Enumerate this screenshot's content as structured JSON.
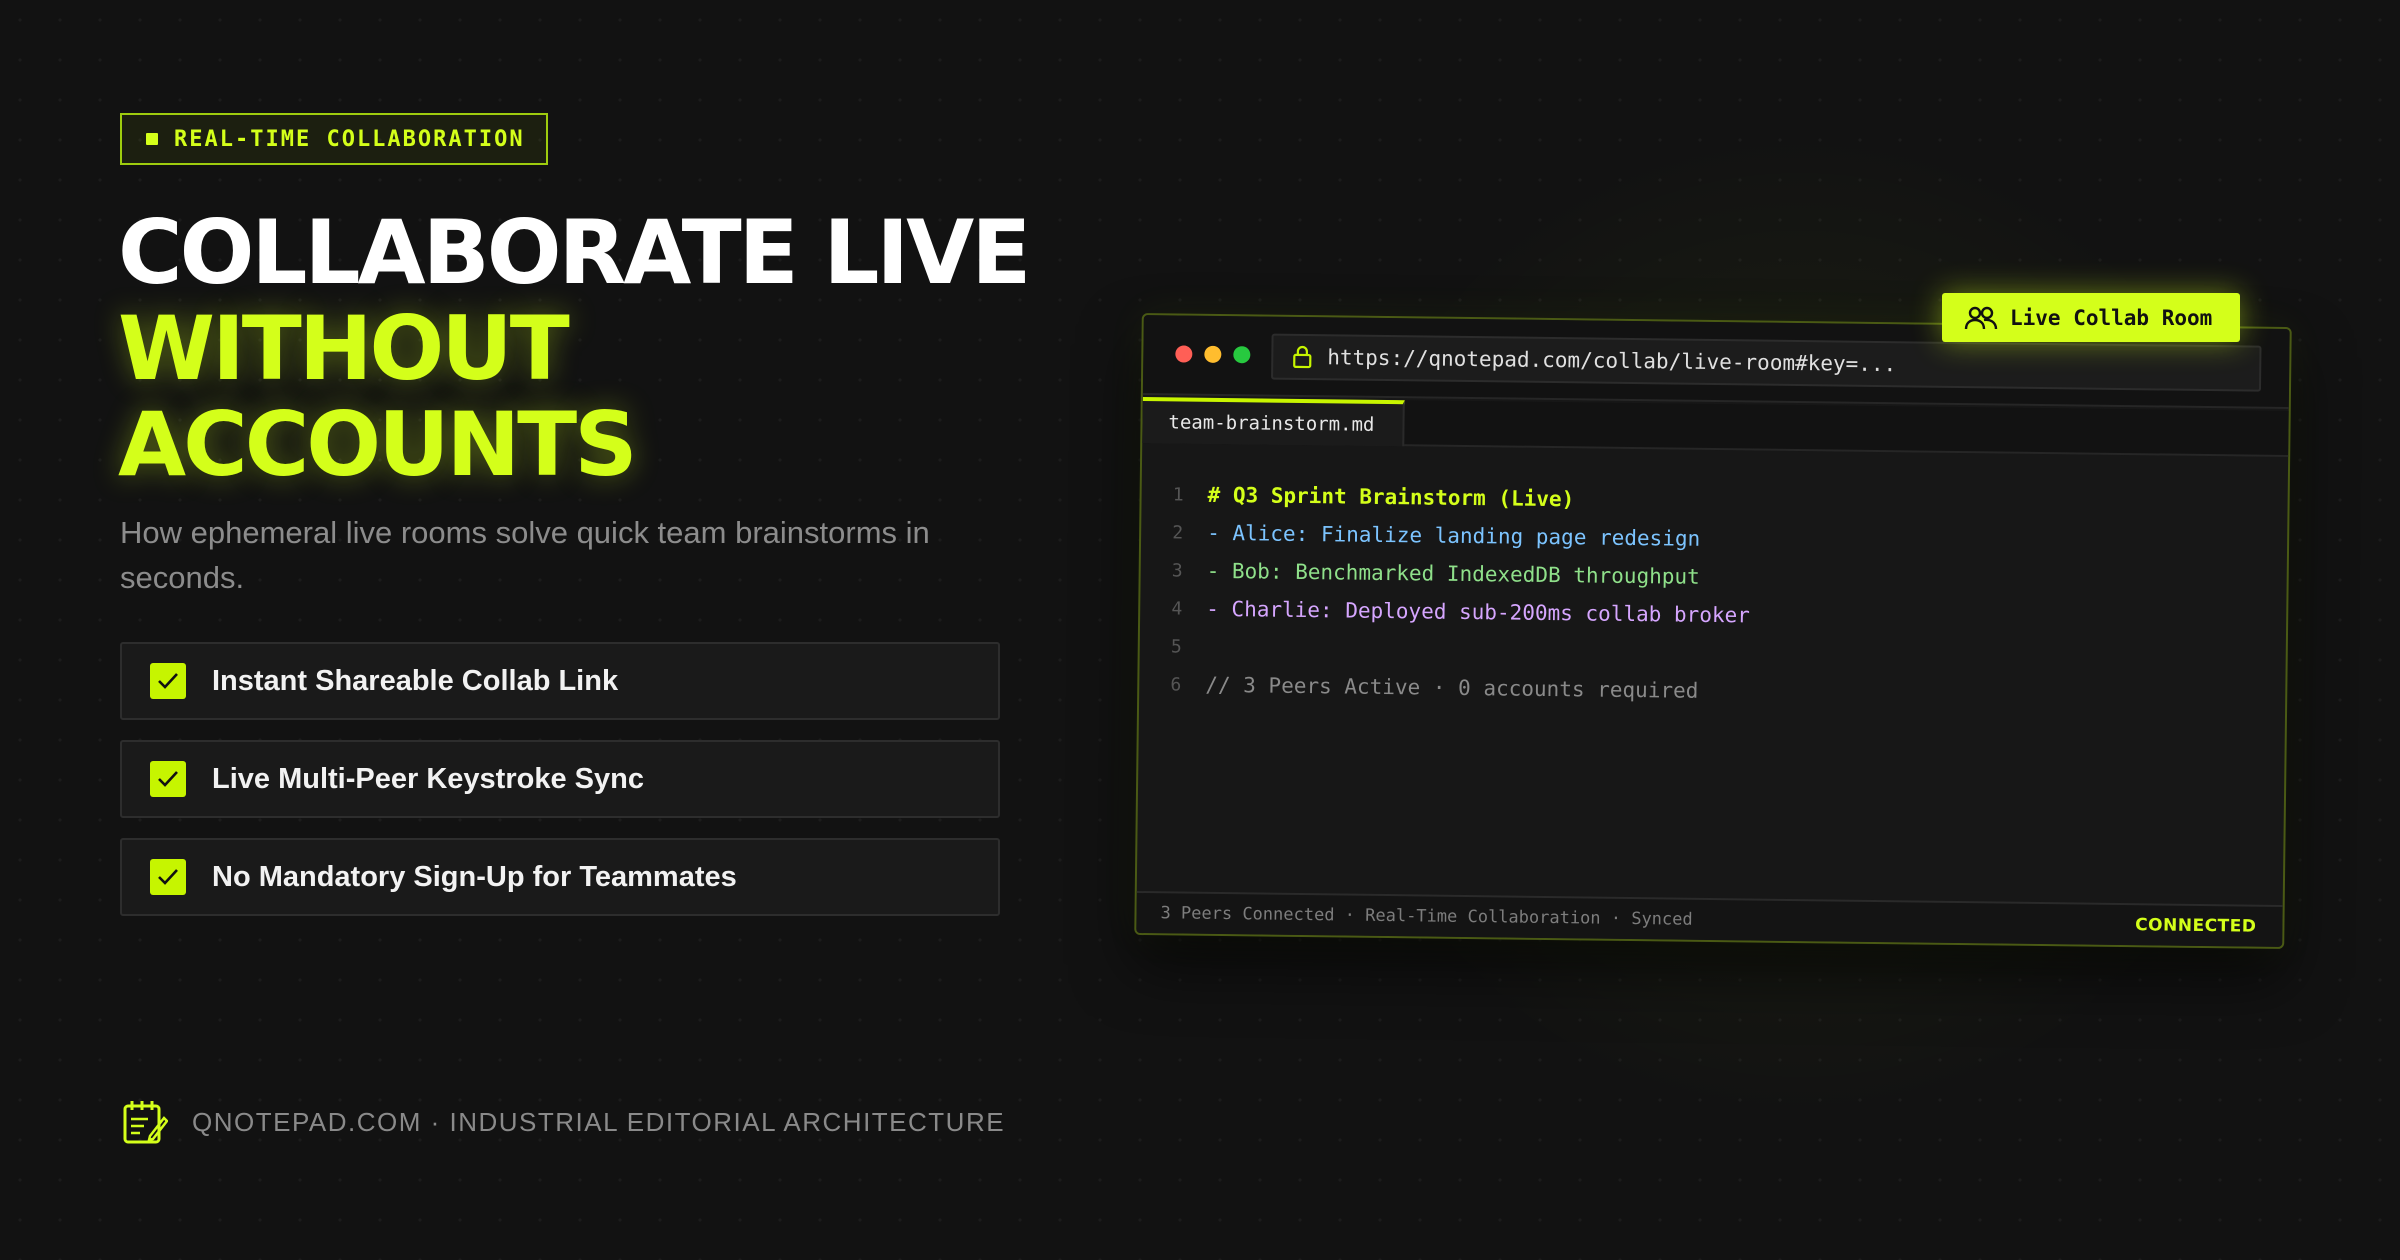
{
  "badge": {
    "icon": "square-dot-icon",
    "label": "REAL-TIME COLLABORATION"
  },
  "headline": {
    "line1": "COLLABORATE LIVE",
    "line2": "WITHOUT",
    "line3": "ACCOUNTS"
  },
  "subtitle": "How ephemeral live rooms solve quick team brainstorms in seconds.",
  "features": [
    {
      "icon": "checkbox-checked-icon",
      "label": "Instant Shareable Collab Link"
    },
    {
      "icon": "checkbox-checked-icon",
      "label": "Live Multi-Peer Keystroke Sync"
    },
    {
      "icon": "checkbox-checked-icon",
      "label": "No Mandatory Sign-Up for Teammates"
    }
  ],
  "footer": {
    "icon": "notepad-icon",
    "text": "QNOTEPAD.COM · INDUSTRIAL EDITORIAL ARCHITECTURE"
  },
  "editor": {
    "url": "https://qnotepad.com/collab/live-room#key=...",
    "tab": "team-brainstorm.md",
    "lines": [
      {
        "num": "1",
        "text": "# Q3 Sprint Brainstorm (Live)"
      },
      {
        "num": "2",
        "text": "- Alice: Finalize landing page redesign"
      },
      {
        "num": "3",
        "text": "- Bob: Benchmarked IndexedDB throughput"
      },
      {
        "num": "4",
        "text": "- Charlie: Deployed sub-200ms collab broker"
      },
      {
        "num": "5",
        "text": ""
      },
      {
        "num": "6",
        "text": "// 3 Peers Active · 0 accounts required"
      }
    ],
    "status_text": "3 Peers Connected · Real-Time Collaboration · Synced",
    "status_badge": "CONNECTED"
  },
  "collab_tag": {
    "icon": "users-icon",
    "label": "Live Collab Room"
  },
  "colors": {
    "accent": "#d4ff1a",
    "background": "#121212",
    "text_muted": "#8c8c8c"
  }
}
